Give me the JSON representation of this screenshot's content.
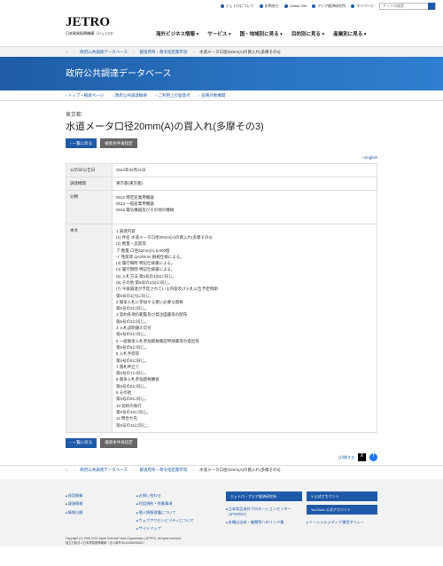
{
  "util": {
    "about": "ジェトロについて",
    "contact": "お問合せ",
    "global": "Global Site",
    "asia": "アジア経済研究所",
    "mypage": "マイページ",
    "search_placeholder": "サイト内検索"
  },
  "logo": {
    "mark": "JETRO",
    "sub": "日本貿易振興機構（ジェトロ）"
  },
  "gnav": [
    "海外ビジネス情報 ▾",
    "サービス ▾",
    "国・地域別に見る ▾",
    "目的別に見る ▾",
    "産業別に見る ▾"
  ],
  "crumb_top": [
    "政府公共調達データベース",
    "都道府県・政令指定都市等",
    "水道メータ口径20mm(A)の買入れ(多摩その3)"
  ],
  "banner": "政府公共調達データベース",
  "subnav": [
    "トップ・検索ページ",
    "政府公共調達概要",
    "ご利用上の留意点",
    "役務対象機関"
  ],
  "dept": "東京都",
  "title": "水道メータ口径20mm(A)の買入れ(多摩その3)",
  "buttons": {
    "back": "一覧に戻る",
    "search_again": "検索条件再指定"
  },
  "lang": "English",
  "table": {
    "date_label": "公示日/公告日",
    "date_value": "2024年02月21日",
    "org_label": "調達機関",
    "org_value": "東京都(東京都)",
    "class_label": "分類",
    "class_values": [
      "0012 特定産業用機器",
      "0013 一般産業用機器",
      "0016 電気機器及びその他の機械"
    ],
    "body_label": "本文",
    "body_lines": [
      "1 調達内容",
      "(1) 件名 水道メータ口径20mm(A)の買入れ(多摩その3)",
      "(2) 数量・品質等",
      "ア 数量 口径20mm(A) 6,000個",
      "イ 性能等 QA20mm 群規仕様による。",
      "(3) 履行場所 特記仕様書による。",
      "(4) 履行期間 特記仕様書による。",
      "(5) 入札方法 第5号の1(5)に同じ。",
      "(6) その他 第5号の1(6)に同じ。",
      "(7) 今後調達が予定されている内容及び入札公告予定時期",
      "第5号の1(7)に同じ。",
      "2 競争入札に参加する者に必要な資格",
      "第5号の2に同じ。",
      "3 契約条項の範覧及び発注図書等の配布",
      "第5号の3に同じ。",
      "4 入札説明書の交付",
      "第5号の4に同じ。",
      "5 一般競争入札参加資格確認申請書等の提出等",
      "第5号の5に同じ。",
      "6 入札手続等",
      "第5号の6に同じ。",
      "7 落札申立て",
      "第5号の7に同じ。",
      "8 競争入札参加資格審査",
      "第5号の8に同じ。",
      "9 その他",
      "第5号の9に同じ。",
      "10 契約の執行",
      "第5号の10に同じ。",
      "11 問合せ先",
      "第5号の11に同じ。"
    ]
  },
  "share": {
    "print": "印刷する",
    "x": "X",
    "fb": "f"
  },
  "crumb_bottom": [
    "政府公共調達データベース",
    "都道府県・政令指定都市等",
    "水道メータ口径20mm(A)の買入れ(多摩その3)"
  ],
  "footer": {
    "col1": [
      "採用情報",
      "調達情報",
      "情報公開"
    ],
    "col2": [
      "お問い合わせ",
      "利用規約・免責事項",
      "個人情報保護について",
      "ウェブアクセシビリティについて",
      "サイトマップ"
    ],
    "asia_btn": "ジェトロ・アジア経済研究所",
    "links3": [
      "日本食品海外プロモーションセンター（JFOODO）",
      "各種自治体・機関等へのリンク集"
    ],
    "x_btn": "X 公式アカウント",
    "yt_btn": "YouTube 公式アカウント",
    "social_link": "ソーシャルメディア運用ポリシー",
    "copyright": "Copyright (C) 1995-2024 Japan External Trade Organization (JETRO). All rights reserved.",
    "corp": "独立行政法人日本貿易振興機構（法人番号 8010405008810）"
  }
}
